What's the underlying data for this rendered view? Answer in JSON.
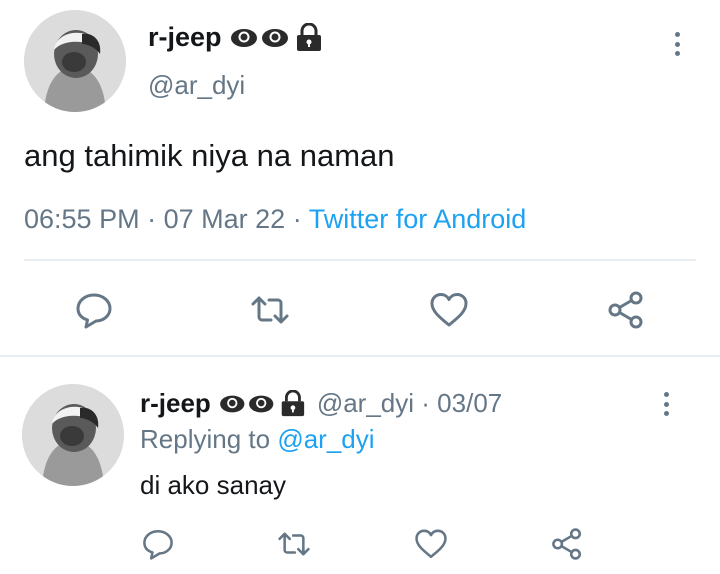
{
  "tweet": {
    "display_name": "r-jeep",
    "badges": [
      "eye-icon",
      "eye-icon",
      "lock-icon"
    ],
    "handle": "@ar_dyi",
    "text": "ang tahimik niya na naman",
    "time": "06:55 PM",
    "separator": "·",
    "date": "07 Mar 22",
    "source": "Twitter for Android",
    "actions": [
      "reply-icon",
      "retweet-icon",
      "like-icon",
      "share-icon"
    ]
  },
  "reply": {
    "display_name": "r-jeep",
    "badges": [
      "eye-icon",
      "eye-icon",
      "lock-icon"
    ],
    "handle": "@ar_dyi",
    "separator": "·",
    "date": "03/07",
    "replying_prefix": "Replying to",
    "replying_handle": "@ar_dyi",
    "text": "di ako sanay",
    "actions": [
      "reply-icon",
      "retweet-icon",
      "like-icon",
      "share-icon"
    ]
  },
  "colors": {
    "text": "#14171a",
    "muted": "#657786",
    "link": "#1da1f2",
    "divider": "#e6ecf0",
    "icon": "#657786"
  }
}
